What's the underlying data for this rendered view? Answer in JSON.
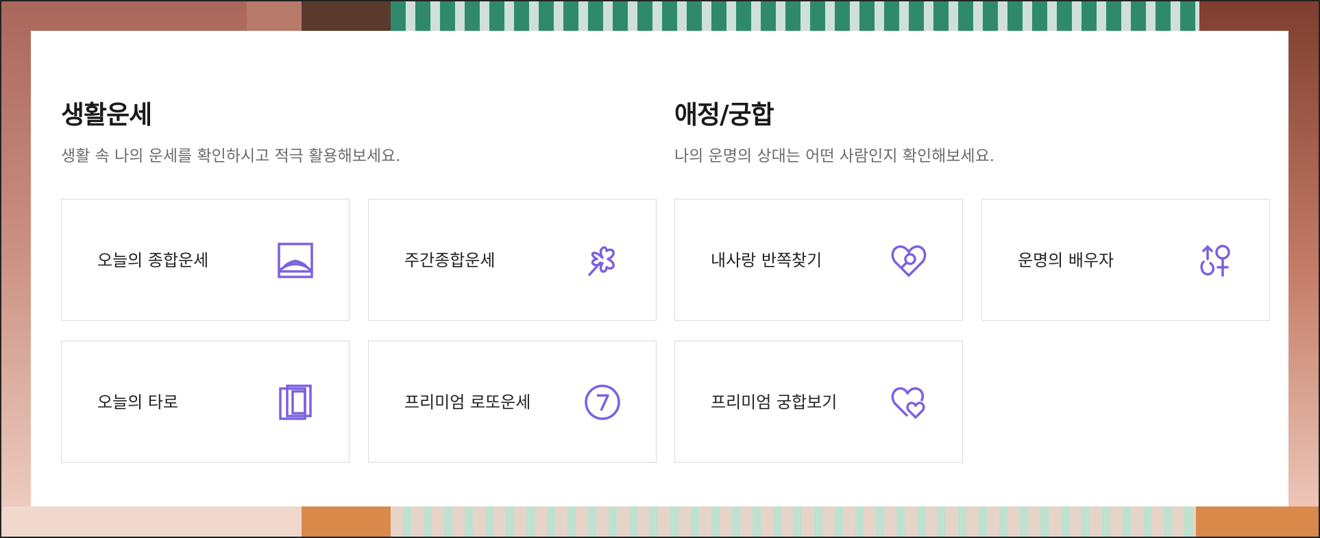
{
  "accent_color": "#7b61e0",
  "sections": [
    {
      "title": "생활운세",
      "subtitle": "생활 속 나의 운세를 확인하시고 적극 활용해보세요.",
      "cards": [
        {
          "label": "오늘의 종합운세",
          "icon": "sunrise-icon"
        },
        {
          "label": "주간종합운세",
          "icon": "clover-icon"
        },
        {
          "label": "오늘의 타로",
          "icon": "tarot-cards-icon"
        },
        {
          "label": "프리미엄 로또운세",
          "icon": "lucky-seven-icon"
        }
      ]
    },
    {
      "title": "애정/궁합",
      "subtitle": "나의 운명의 상대는 어떤 사람인지 확인해보세요.",
      "cards": [
        {
          "label": "내사랑 반쪽찾기",
          "icon": "heart-search-icon"
        },
        {
          "label": "운명의 배우자",
          "icon": "gender-symbols-icon"
        },
        {
          "label": "프리미엄 궁합보기",
          "icon": "double-heart-icon"
        }
      ]
    }
  ]
}
